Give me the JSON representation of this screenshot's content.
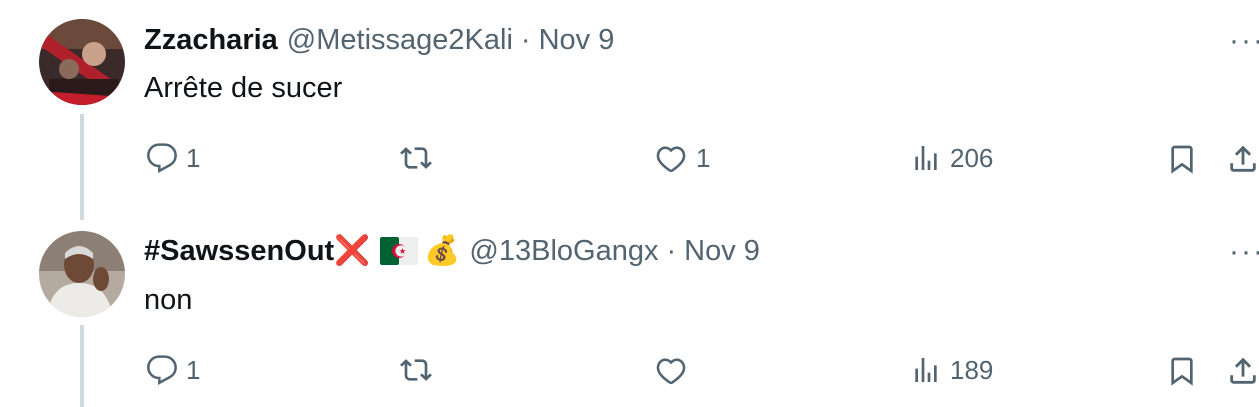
{
  "tweets": [
    {
      "name": "Zzacharia",
      "handle": "@Metissage2Kali",
      "separator": "·",
      "date": "Nov 9",
      "text": "Arrête de sucer",
      "more": "···",
      "reply_count": "1",
      "retweet_count": "",
      "like_count": "1",
      "views_count": "206"
    },
    {
      "name": "#SawssenOut",
      "name_emoji": "❌",
      "badge_emoji": "💰",
      "handle": "@13BloGangx",
      "separator": "·",
      "date": "Nov 9",
      "text": "non",
      "more": "···",
      "reply_count": "1",
      "retweet_count": "",
      "like_count": "",
      "views_count": "189"
    }
  ],
  "colors": {
    "muted": "#536471",
    "text": "#0f1419",
    "thread_line": "#cfd9de",
    "red_x": "#e0245e"
  }
}
